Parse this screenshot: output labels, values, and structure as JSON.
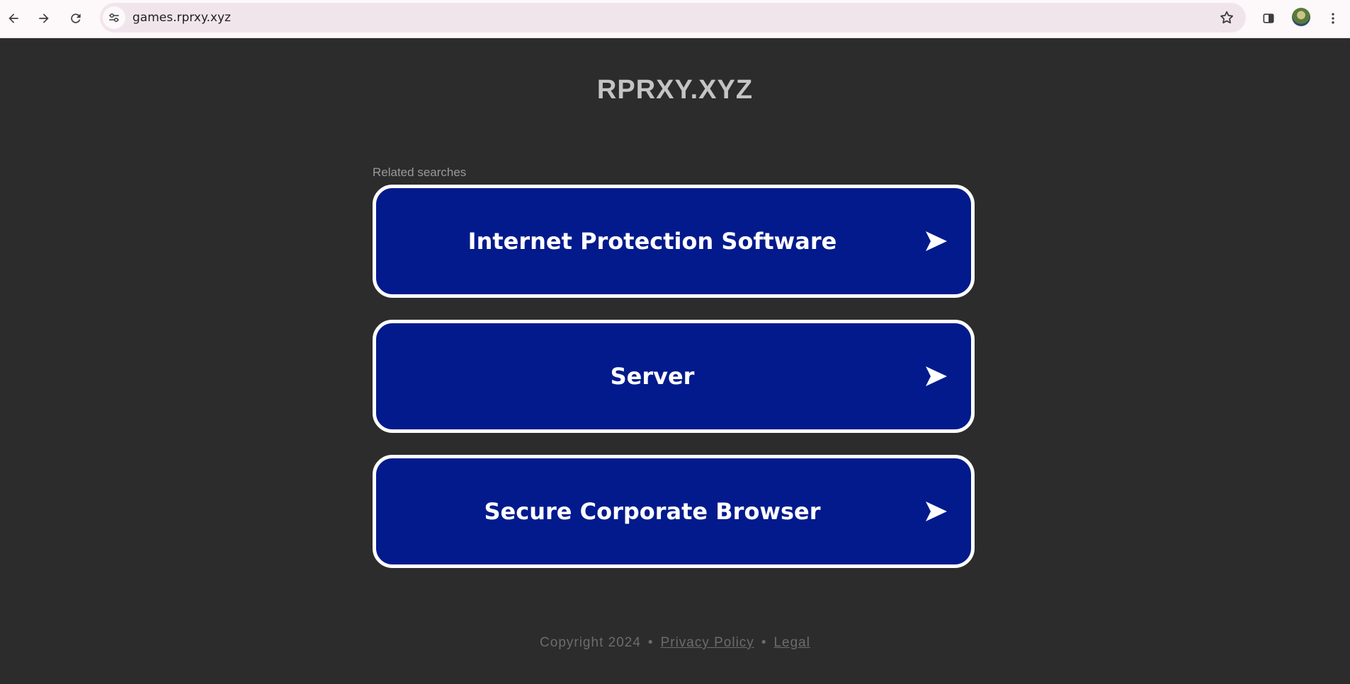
{
  "browser": {
    "url": "games.rprxy.xyz",
    "icons": [
      "back-arrow-icon",
      "forward-arrow-icon",
      "reload-icon",
      "site-info-icon",
      "bookmark-star-icon",
      "side-panel-icon",
      "profile-avatar",
      "kebab-menu-icon"
    ]
  },
  "page": {
    "site_title": "RPRXY.XYZ",
    "related_label": "Related searches",
    "related_items": [
      {
        "label": "Internet Protection Software"
      },
      {
        "label": "Server"
      },
      {
        "label": "Secure Corporate Browser"
      }
    ],
    "button_colors": {
      "background": "#031a8c",
      "border": "#ffffff"
    },
    "footer": {
      "copyright": "Copyright 2024",
      "separator": "•",
      "privacy": "Privacy Policy",
      "legal": "Legal"
    }
  }
}
